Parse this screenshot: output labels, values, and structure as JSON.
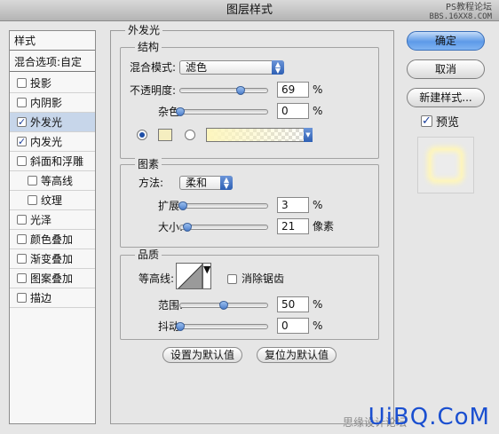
{
  "window": {
    "title": "图层样式"
  },
  "watermark_top": {
    "line1": "PS教程论坛",
    "line2": "BBS.16XX8.COM"
  },
  "watermark_bottom": {
    "text": "UiBQ.CoM",
    "faint": "思缘设计论坛"
  },
  "left_panel": {
    "header": "样式",
    "blend_options": "混合选项:自定",
    "items": [
      {
        "label": "投影",
        "checked": false
      },
      {
        "label": "内阴影",
        "checked": false
      },
      {
        "label": "外发光",
        "checked": true
      },
      {
        "label": "内发光",
        "checked": true
      },
      {
        "label": "斜面和浮雕",
        "checked": false
      },
      {
        "label": "等高线",
        "checked": false
      },
      {
        "label": "纹理",
        "checked": false
      },
      {
        "label": "光泽",
        "checked": false
      },
      {
        "label": "颜色叠加",
        "checked": false
      },
      {
        "label": "渐变叠加",
        "checked": false
      },
      {
        "label": "图案叠加",
        "checked": false
      },
      {
        "label": "描边",
        "checked": false
      }
    ]
  },
  "outer_glow": {
    "title": "外发光",
    "structure": {
      "title": "结构",
      "blend_mode_label": "混合模式:",
      "blend_mode_value": "滤色",
      "opacity_label": "不透明度:",
      "opacity_value": "69",
      "opacity_pct": 69,
      "noise_label": "杂色:",
      "noise_value": "0",
      "noise_pct": 0,
      "percent": "%",
      "glow_color": "#f5eec0"
    },
    "elements": {
      "title": "图素",
      "technique_label": "方法:",
      "technique_value": "柔和",
      "spread_label": "扩展:",
      "spread_value": "3",
      "spread_pct": 3,
      "size_label": "大小:",
      "size_value": "21",
      "size_pct": 8.4,
      "percent": "%",
      "pixels": "像素"
    },
    "quality": {
      "title": "品质",
      "contour_label": "等高线:",
      "anti_alias_label": "消除锯齿",
      "range_label": "范围:",
      "range_value": "50",
      "range_pct": 50,
      "jitter_label": "抖动:",
      "jitter_value": "0",
      "jitter_pct": 0,
      "percent": "%"
    },
    "make_default": "设置为默认值",
    "reset_default": "复位为默认值"
  },
  "right_panel": {
    "ok": "确定",
    "cancel": "取消",
    "new_style": "新建样式...",
    "preview": "预览"
  }
}
